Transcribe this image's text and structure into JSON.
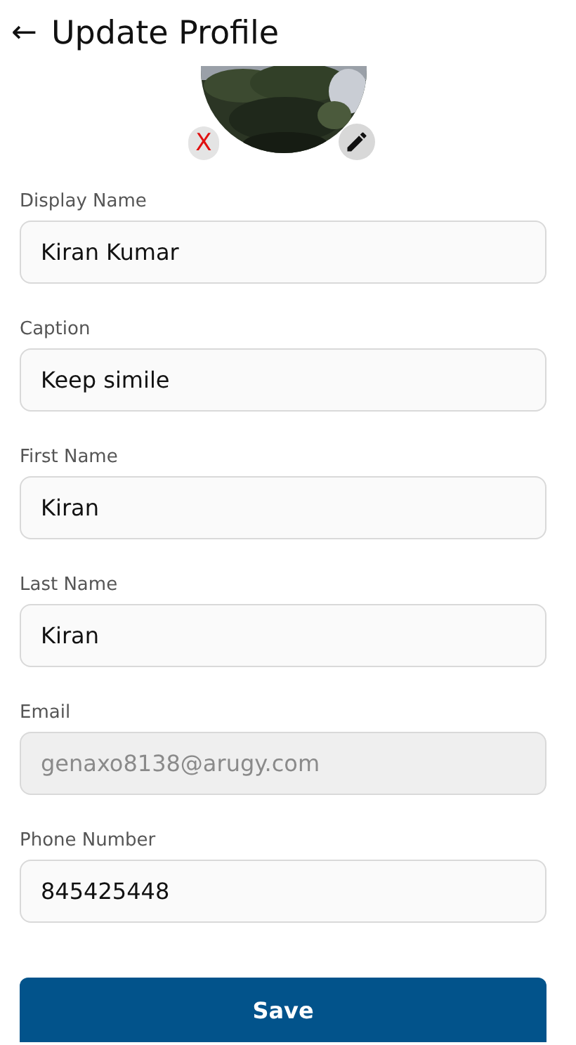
{
  "header": {
    "back_icon": "←",
    "title": "Update Profile"
  },
  "avatar": {
    "kind": "picture",
    "remove_label": "X"
  },
  "fields": [
    {
      "label": "Display Name",
      "value": "Kiran Kumar",
      "disabled": false
    },
    {
      "label": "Caption",
      "value": "Keep simile",
      "disabled": false
    },
    {
      "label": "First Name",
      "value": "Kiran",
      "disabled": false
    },
    {
      "label": "Last Name",
      "value": "Kiran",
      "disabled": false
    },
    {
      "label": "Email",
      "value": "genaxo8138@arugy.com",
      "disabled": true
    },
    {
      "label": "Phone Number",
      "value": "845425448",
      "disabled": false
    }
  ],
  "save_button": "Save"
}
